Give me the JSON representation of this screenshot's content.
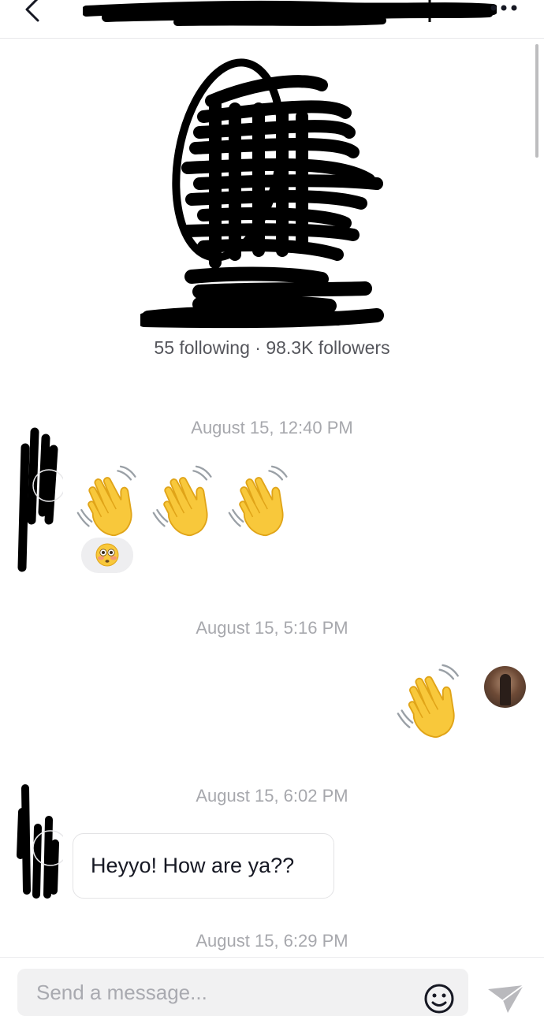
{
  "header": {
    "back_icon": "chevron-left-icon",
    "more_icon": "more-horizontal-icon"
  },
  "profile": {
    "stats": "55 following · 98.3K followers"
  },
  "messages": [
    {
      "timestamp": "August 15, 12:40 PM",
      "sender": "them",
      "content": "👋👋👋",
      "reaction": "😳"
    },
    {
      "timestamp": "August 15, 5:16 PM",
      "sender": "me",
      "content": "👋"
    },
    {
      "timestamp": "August 15, 6:02 PM",
      "sender": "them",
      "content": "Heyyo! How are ya??"
    },
    {
      "timestamp": "August 15, 6:29 PM"
    }
  ],
  "composer": {
    "placeholder": "Send a message...",
    "emoji_icon": "emoji-icon",
    "send_icon": "send-icon"
  },
  "colors": {
    "timestamp": "#a7a8ad",
    "stats": "#55565c",
    "wave_yellow": "#f8c83b",
    "divider": "#e8e8ea"
  }
}
